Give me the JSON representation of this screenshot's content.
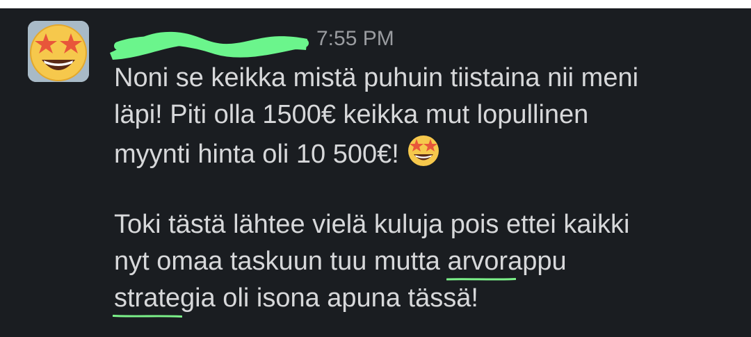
{
  "message": {
    "time": "7:55 PM",
    "avatar_icon": "star-struck-emoji-icon",
    "paragraph1": {
      "line1": "Noni se keikka mistä puhuin tiistaina nii meni",
      "line2": "läpi! Piti olla 1500€ keikka mut lopullinen",
      "line3": "myynti hinta oli 10 500€!"
    },
    "inline_emoji": "star-struck-emoji-icon",
    "paragraph2": {
      "line1": "Toki tästä lähtee vielä kuluja pois ettei kaikki",
      "line2_plain": "nyt omaa taskuun tuu mutta ",
      "line2_highlight": "arvorappu",
      "line3_highlight": "strategia oli isona apuna tässä!"
    },
    "colors": {
      "background": "#1a1d21",
      "text": "#d7d8da",
      "timestamp": "#9a9ca0",
      "highlight_green": "#7cf28a",
      "redaction_green": "#6bf58c"
    }
  }
}
